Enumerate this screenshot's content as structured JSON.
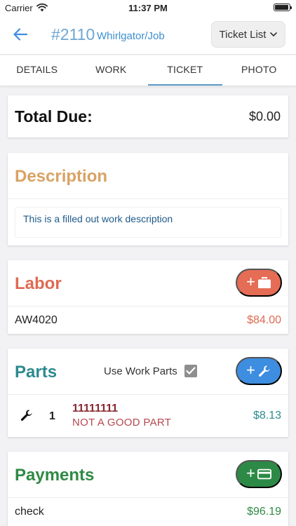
{
  "status_bar": {
    "carrier": "Carrier",
    "time": "11:37 PM"
  },
  "nav": {
    "ticket_number": "#2110",
    "job_name": "Whirlgator/Job",
    "ticket_list_label": "Ticket List"
  },
  "tabs": [
    {
      "label": "DETAILS"
    },
    {
      "label": "WORK"
    },
    {
      "label": "TICKET",
      "active": true
    },
    {
      "label": "PHOTO"
    }
  ],
  "total": {
    "label": "Total Due:",
    "value": "$0.00"
  },
  "description": {
    "title": "Description",
    "text": "This is a filled out work description"
  },
  "labor": {
    "title": "Labor",
    "items": [
      {
        "code": "AW4020",
        "amount": "$84.00"
      }
    ]
  },
  "parts": {
    "title": "Parts",
    "use_work_parts_label": "Use Work Parts",
    "use_work_parts_checked": true,
    "items": [
      {
        "qty": "1",
        "part_number": "11111111",
        "name": "NOT A GOOD PART",
        "amount": "$8.13"
      }
    ]
  },
  "payments": {
    "title": "Payments",
    "items": [
      {
        "method": "check",
        "amount": "$96.19"
      }
    ]
  },
  "colors": {
    "description": "#d9a263",
    "labor": "#df6a52",
    "parts": "#2c8a8f",
    "payments": "#2f8a45",
    "accent_blue": "#3d8de0"
  },
  "icons": {
    "labor_add": "briefcase-icon",
    "parts_add": "wrench-icon",
    "payments_add": "credit-card-icon",
    "back": "arrow-left-icon"
  }
}
